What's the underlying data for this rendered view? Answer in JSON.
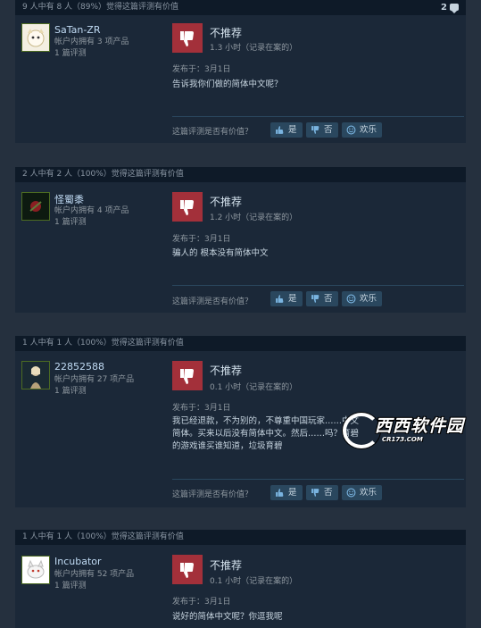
{
  "labels": {
    "not_recommended": "不推荐",
    "helpful_question": "这篇评测是否有价值？",
    "yes": "是",
    "no": "否",
    "funny": "欢乐"
  },
  "reviews": [
    {
      "helpful_text": "9 人中有 8 人（89%）觉得这篇评测有价值",
      "comment_count": "2",
      "user_name": "SaTan-ZR",
      "owned": "帐户内拥有 3 项产品",
      "review_count": "1 篇评测",
      "hours": "1.3 小时（记录在案的）",
      "posted": "发布于：3月1日",
      "text": "告诉我你们做的简体中文呢？"
    },
    {
      "helpful_text": "2 人中有 2 人（100%）觉得这篇评测有价值",
      "user_name": "怪蜀黍",
      "owned": "帐户内拥有 4 项产品",
      "review_count": "1 篇评测",
      "hours": "1.2 小时（记录在案的）",
      "posted": "发布于：3月1日",
      "text": "骗人的 根本没有简体中文"
    },
    {
      "helpful_text": "1 人中有 1 人（100%）觉得这篇评测有价值",
      "user_name": "22852588",
      "owned": "帐户内拥有 27 项产品",
      "review_count": "1 篇评测",
      "hours": "0.1 小时（记录在案的）",
      "posted": "发布于：3月1日",
      "text": "我已经退款，不为别的，不尊重中国玩家……中文简体。买来以后没有简体中文。然后……吗？育碧的游戏谁买谁知道，垃圾育碧"
    },
    {
      "helpful_text": "1 人中有 1 人（100%）觉得这篇评测有价值",
      "user_name": "Incubator",
      "owned": "帐户内拥有 52 项产品",
      "review_count": "1 篇评测",
      "hours": "0.1 小时（记录在案的）",
      "posted": "发布于：3月1日",
      "text": "说好的简体中文呢？你逗我呢"
    }
  ],
  "watermark": {
    "main": "西西软件园",
    "sub": "CR173.COM"
  }
}
